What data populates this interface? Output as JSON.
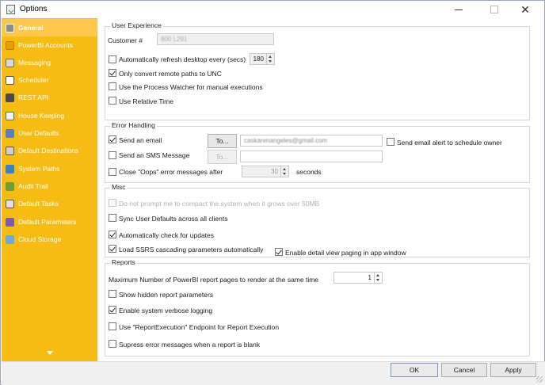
{
  "window": {
    "title": "Options"
  },
  "sidebar": {
    "items": [
      {
        "label": "General",
        "icon": "general-icon",
        "active": true
      },
      {
        "label": "PowerBI Accounts",
        "icon": "powerbi-icon"
      },
      {
        "label": "Messaging",
        "icon": "messaging-icon"
      },
      {
        "label": "Scheduler",
        "icon": "clock-icon"
      },
      {
        "label": "REST API",
        "icon": "api-icon"
      },
      {
        "label": "House Keeping",
        "icon": "housekeeping-icon"
      },
      {
        "label": "User Defaults",
        "icon": "user-icon"
      },
      {
        "label": "Default Destinations",
        "icon": "destination-icon"
      },
      {
        "label": "System Paths",
        "icon": "globe-icon"
      },
      {
        "label": "Audit Trail",
        "icon": "audit-icon"
      },
      {
        "label": "Default Tasks",
        "icon": "tasks-icon"
      },
      {
        "label": "Default Parameters",
        "icon": "parameters-icon"
      },
      {
        "label": "Cloud Storage",
        "icon": "cloud-icon"
      }
    ],
    "accent": "#f7bc13"
  },
  "user_experience": {
    "title": "User Experience",
    "customer_label": "Customer #",
    "customer_value": "800 L291",
    "auto_refresh_label": "Automatically refresh desktop every (secs)",
    "auto_refresh_checked": false,
    "auto_refresh_value": "180",
    "unc_label": "Only convert remote paths to UNC",
    "unc_checked": true,
    "watcher_label": "Use the Process Watcher for manual executions",
    "watcher_checked": false,
    "relative_time_label": "Use Relative Time",
    "relative_time_checked": false
  },
  "error_handling": {
    "title": "Error Handling",
    "send_email_label": "Send an email",
    "send_email_checked": true,
    "to_button": "To...",
    "email_value": "caskarenangeles@gmail.com",
    "alert_owner_label": "Send email alert to schedule owner",
    "alert_owner_checked": false,
    "sms_label": "Send an SMS Message",
    "sms_checked": false,
    "sms_to_button": "To...",
    "close_oops_label": "Close \"Oops\" error messages after",
    "close_oops_checked": false,
    "close_oops_value": "30",
    "seconds_label": "seconds"
  },
  "misc": {
    "title": "Misc",
    "compact_label": "Do not prompt me to compact the system when it grows over 50MB",
    "compact_checked": false,
    "sync_label": "Sync User Defaults across all clients",
    "sync_checked": false,
    "updates_label": "Automatically check for updates",
    "updates_checked": true,
    "ssrs_label": "Load SSRS cascading parameters automatically",
    "ssrs_checked": true,
    "paging_label": "Enable detail view paging in app window",
    "paging_checked": true
  },
  "reports": {
    "title": "Reports",
    "max_pages_label": "Maximum Number of PowerBI report pages to render at the same time",
    "max_pages_value": "1",
    "hidden_params_label": "Show hidden report parameters",
    "hidden_params_checked": false,
    "verbose_label": "Enable system verbose logging",
    "verbose_checked": true,
    "endpoint_label": "Use \"ReportExecution\" Endpoint for Report Execution",
    "endpoint_checked": false,
    "suppress_label": "Supress error messages when a report is blank",
    "suppress_checked": false
  },
  "footer": {
    "ok": "OK",
    "cancel": "Cancel",
    "apply": "Apply"
  }
}
